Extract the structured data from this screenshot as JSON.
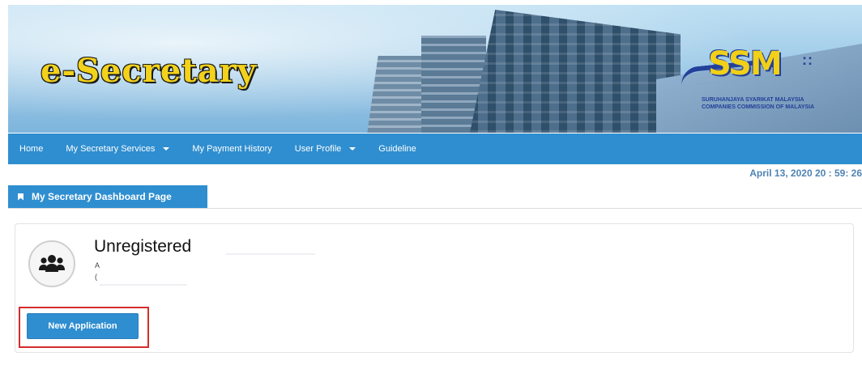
{
  "header": {
    "logo_text": "e-Secretary",
    "ssm": {
      "mark": "SSM",
      "dots": "::",
      "line1": "SURUHANJAYA SYARIKAT MALAYSIA",
      "line2": "COMPANIES COMMISSION OF MALAYSIA"
    }
  },
  "nav": {
    "items": [
      {
        "label": "Home",
        "dropdown": false
      },
      {
        "label": "My Secretary Services",
        "dropdown": true
      },
      {
        "label": "My Payment History",
        "dropdown": false
      },
      {
        "label": "User Profile",
        "dropdown": true
      },
      {
        "label": "Guideline",
        "dropdown": false
      }
    ]
  },
  "datetime": "April 13, 2020 20 : 59: 26",
  "page_tab": {
    "label": "My Secretary Dashboard Page",
    "icon": "bookmark-icon"
  },
  "card": {
    "avatar_icon": "users-icon",
    "status_title": "Unregistered",
    "sub_line_1": "A",
    "sub_line_2": "(",
    "button_label": "New Application",
    "highlight_color": "#d42d2d"
  },
  "colors": {
    "nav_blue": "#2f8ed0",
    "date_text": "#4f83b4"
  }
}
